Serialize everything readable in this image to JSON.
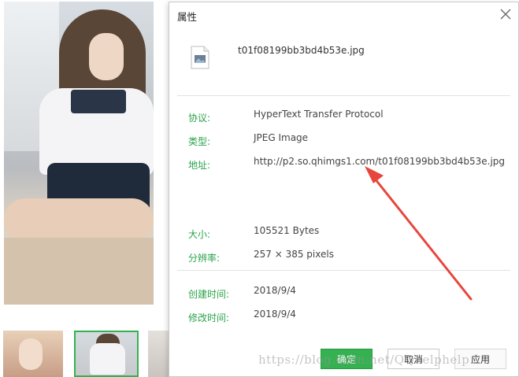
{
  "dialog": {
    "title": "属性",
    "file_name": "t01f08199bb3bd4b53e.jpg",
    "fields": [
      {
        "label": "协议:",
        "value": "HyperText Transfer Protocol"
      },
      {
        "label": "类型:",
        "value": "JPEG Image"
      },
      {
        "label": "地址:",
        "value": "http://p2.so.qhimgs1.com/t01f08199bb3bd4b53e.jpg"
      },
      {
        "label": "大小:",
        "value": "105521 Bytes"
      },
      {
        "label": "分辨率:",
        "value": "257 × 385 pixels"
      },
      {
        "label": "创建时间:",
        "value": "2018/9/4"
      },
      {
        "label": "修改时间:",
        "value": "2018/9/4"
      }
    ],
    "buttons": {
      "ok": "确定",
      "cancel": "取消",
      "apply": "应用"
    }
  },
  "watermark": "https://blog.csdn.net/QQhelphelp",
  "colors": {
    "accent": "#35b152",
    "label": "#2aa34a",
    "arrow": "#e8453c"
  },
  "icons": {
    "close": "close-icon",
    "file": "image-file-icon"
  }
}
